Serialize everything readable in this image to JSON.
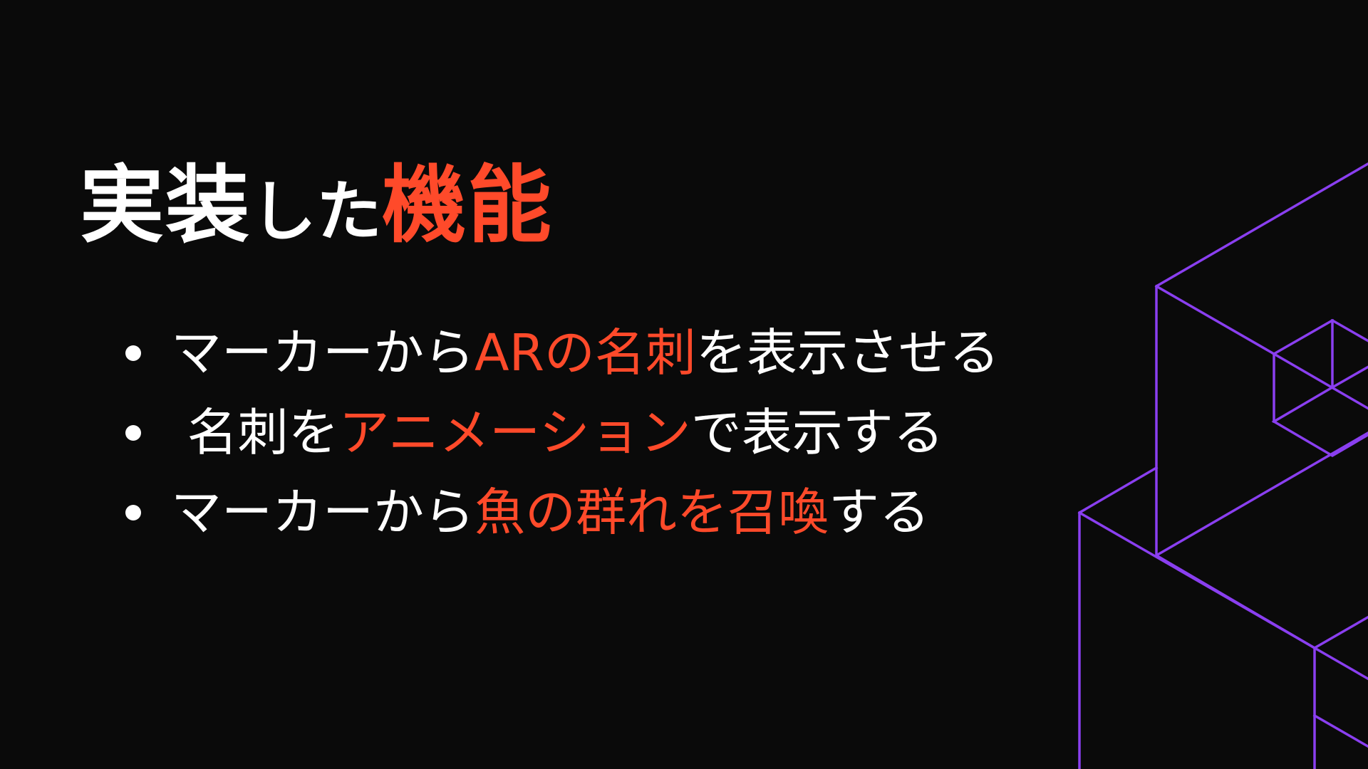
{
  "title": {
    "part1": "実装",
    "part2": "した",
    "part3": "機能"
  },
  "bullets": [
    {
      "segments": [
        {
          "text": "マーカーから",
          "accent": false
        },
        {
          "text": "ARの名刺",
          "accent": true
        },
        {
          "text": "を表示させる",
          "accent": false
        }
      ]
    },
    {
      "segments": [
        {
          "text": " 名刺を",
          "accent": false
        },
        {
          "text": "アニメーション",
          "accent": true
        },
        {
          "text": "で表示する",
          "accent": false
        }
      ]
    },
    {
      "segments": [
        {
          "text": "マーカーから",
          "accent": false
        },
        {
          "text": "魚の群れを召喚",
          "accent": true
        },
        {
          "text": "する",
          "accent": false
        }
      ]
    }
  ],
  "colors": {
    "background": "#0a0a0a",
    "text": "#ffffff",
    "accent": "#ff4a2a",
    "decoration": "#8a3ff0"
  }
}
